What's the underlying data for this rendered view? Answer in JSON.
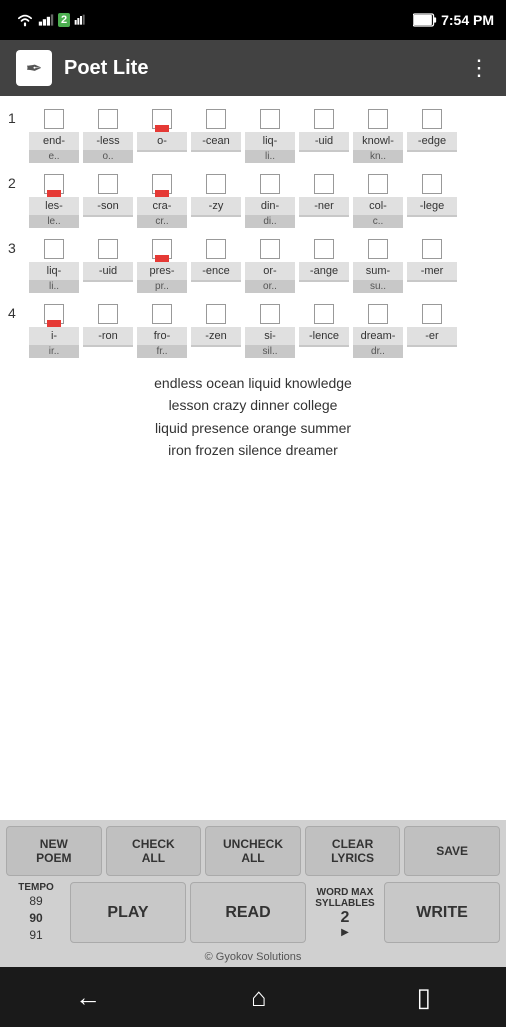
{
  "statusBar": {
    "time": "7:54 PM"
  },
  "titleBar": {
    "title": "Poet Lite",
    "menuIcon": "⋮"
  },
  "rows": [
    {
      "number": "1",
      "words": [
        {
          "text": "end-",
          "sub": "e..",
          "checked": false,
          "flag": false
        },
        {
          "text": "-less",
          "sub": "o..",
          "checked": false,
          "flag": false
        },
        {
          "text": "o-",
          "sub": "",
          "checked": false,
          "flag": true
        },
        {
          "text": "-cean",
          "sub": "",
          "checked": false,
          "flag": false
        },
        {
          "text": "liq-",
          "sub": "li..",
          "checked": false,
          "flag": false
        },
        {
          "text": "-uid",
          "sub": "",
          "checked": false,
          "flag": false
        },
        {
          "text": "knowl-",
          "sub": "kn..",
          "checked": false,
          "flag": false
        },
        {
          "text": "-edge",
          "sub": "",
          "checked": false,
          "flag": false
        }
      ]
    },
    {
      "number": "2",
      "words": [
        {
          "text": "les-",
          "sub": "le..",
          "checked": false,
          "flag": true
        },
        {
          "text": "-son",
          "sub": "",
          "checked": false,
          "flag": false
        },
        {
          "text": "cra-",
          "sub": "cr..",
          "checked": false,
          "flag": true
        },
        {
          "text": "-zy",
          "sub": "",
          "checked": false,
          "flag": false
        },
        {
          "text": "din-",
          "sub": "di..",
          "checked": false,
          "flag": false
        },
        {
          "text": "-ner",
          "sub": "",
          "checked": false,
          "flag": false
        },
        {
          "text": "col-",
          "sub": "c..",
          "checked": false,
          "flag": false
        },
        {
          "text": "-lege",
          "sub": "",
          "checked": false,
          "flag": false
        }
      ]
    },
    {
      "number": "3",
      "words": [
        {
          "text": "liq-",
          "sub": "li..",
          "checked": false,
          "flag": false
        },
        {
          "text": "-uid",
          "sub": "",
          "checked": false,
          "flag": false
        },
        {
          "text": "pres-",
          "sub": "pr..",
          "checked": false,
          "flag": true
        },
        {
          "text": "-ence",
          "sub": "",
          "checked": false,
          "flag": false
        },
        {
          "text": "or-",
          "sub": "or..",
          "checked": false,
          "flag": false
        },
        {
          "text": "-ange",
          "sub": "",
          "checked": false,
          "flag": false
        },
        {
          "text": "sum-",
          "sub": "su..",
          "checked": false,
          "flag": false
        },
        {
          "text": "-mer",
          "sub": "",
          "checked": false,
          "flag": false
        }
      ]
    },
    {
      "number": "4",
      "words": [
        {
          "text": "i-",
          "sub": "ir..",
          "checked": false,
          "flag": true
        },
        {
          "text": "-ron",
          "sub": "",
          "checked": false,
          "flag": false
        },
        {
          "text": "fro-",
          "sub": "fr..",
          "checked": false,
          "flag": false
        },
        {
          "text": "-zen",
          "sub": "",
          "checked": false,
          "flag": false
        },
        {
          "text": "si-",
          "sub": "sil..",
          "checked": false,
          "flag": false
        },
        {
          "text": "-lence",
          "sub": "",
          "checked": false,
          "flag": false
        },
        {
          "text": "dream-",
          "sub": "dr..",
          "checked": false,
          "flag": false
        },
        {
          "text": "-er",
          "sub": "",
          "checked": false,
          "flag": false
        }
      ]
    }
  ],
  "lyrics": [
    "endless ocean liquid knowledge",
    "lesson crazy dinner college",
    "liquid presence orange summer",
    "iron frozen silence dreamer"
  ],
  "buttons": {
    "newPoem": "NEW\nPOEM",
    "checkAll": "CHECK\nALL",
    "uncheckAll": "UNCHECK\nALL",
    "clearLyrics": "CLEAR\nLYRICS",
    "save": "SAVE"
  },
  "controls": {
    "tempoLabel": "TEMPO",
    "tempoValues": "89\n90\n91",
    "play": "PLAY",
    "read": "READ",
    "wordMaxLabel": "WORD MAX\nSYLLABLES",
    "wordMaxValue": "2",
    "write": "WRITE"
  },
  "copyright": "© Gyokov Solutions"
}
